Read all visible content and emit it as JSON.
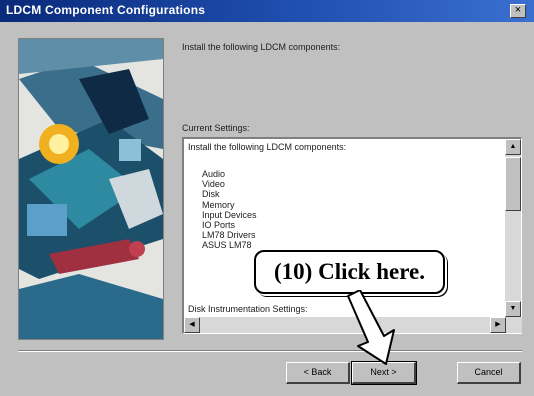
{
  "window": {
    "title": "LDCM Component Configurations",
    "close_glyph": "×"
  },
  "intro_text": "Install the following LDCM components:",
  "settings": {
    "label": "Current Settings:",
    "header": "Install the following LDCM components:",
    "components": [
      "Audio",
      "Video",
      "Disk",
      "Memory",
      "Input Devices",
      "IO Ports",
      "LM78 Drivers",
      "ASUS LM78"
    ],
    "section_label": "Disk Instrumentation Settings:"
  },
  "buttons": {
    "back": "< Back",
    "next": "Next >",
    "cancel": "Cancel"
  },
  "annotation": {
    "text": "(10)  Click here."
  },
  "colors": {
    "title_start": "#0a2a7a",
    "title_end": "#3a6fd0",
    "dialog_bg": "#c0c0c0"
  }
}
